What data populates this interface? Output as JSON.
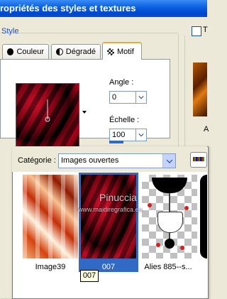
{
  "window": {
    "title": "ropriétés des styles et textures"
  },
  "style_group": {
    "label": "Style"
  },
  "right_panel": {
    "checkbox_label": "T",
    "partial_label": "A"
  },
  "tabs": [
    {
      "label": "Couleur",
      "icon": "color-circle-icon"
    },
    {
      "label": "Dégradé",
      "icon": "gradient-icon"
    },
    {
      "label": "Motif",
      "icon": "pattern-icon",
      "active": true
    }
  ],
  "motif": {
    "angle_label": "Angle :",
    "angle_value": "0",
    "scale_label": "Échelle :",
    "scale_value": "100"
  },
  "pattern_picker": {
    "category_label": "Catégorie :",
    "category_value": "Images ouvertes",
    "items": [
      {
        "label": "Image39"
      },
      {
        "label": "007",
        "selected": true
      },
      {
        "label": "Alies 885--s..."
      }
    ],
    "tooltip": "007"
  },
  "watermark": {
    "name": "Pinuccia",
    "url": "www.maidiregrafica.eu"
  },
  "colors": {
    "titlebar": "#0a5ee0",
    "selection": "#316ac5",
    "tab_accent": "#f2a735"
  }
}
